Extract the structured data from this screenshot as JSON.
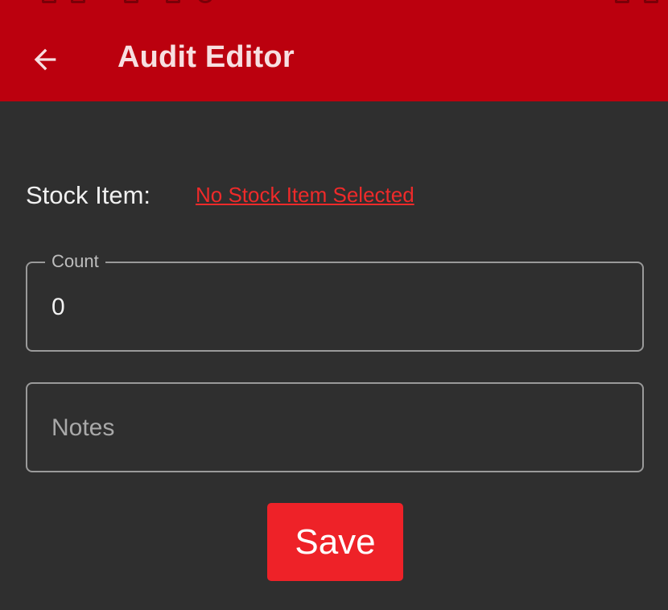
{
  "app_bar": {
    "title": "Audit Editor",
    "back_icon": "arrow-left-icon",
    "background_color": "#bb000e"
  },
  "form": {
    "stock_item": {
      "label": "Stock Item:",
      "value_link": "No Stock Item Selected",
      "link_color": "#ee2a2a"
    },
    "count": {
      "label": "Count",
      "value": "0"
    },
    "notes": {
      "placeholder": "Notes",
      "value": ""
    }
  },
  "actions": {
    "save_label": "Save",
    "save_color": "#ee2228"
  }
}
